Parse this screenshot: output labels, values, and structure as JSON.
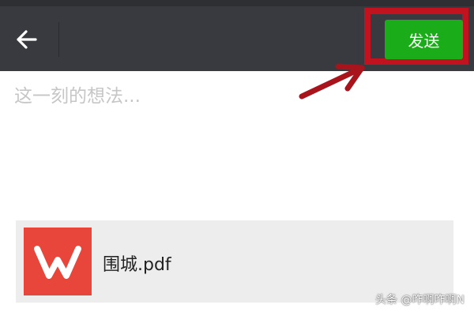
{
  "header": {
    "back_icon": "arrow-left-icon",
    "send_label": "发送"
  },
  "annotation": {
    "highlight_color": "#c1121f",
    "arrow_color": "#a8141c"
  },
  "compose": {
    "placeholder": "这一刻的想法...",
    "value": ""
  },
  "attachment": {
    "icon": "wps-office-icon",
    "file_name": "围城.pdf"
  },
  "watermark": {
    "text": "头条 @咋啊咋啊N"
  },
  "colors": {
    "topbar": "#393a3f",
    "send_button": "#1aad19",
    "wps_brand": "#e8463a",
    "card_bg": "#ededed"
  }
}
